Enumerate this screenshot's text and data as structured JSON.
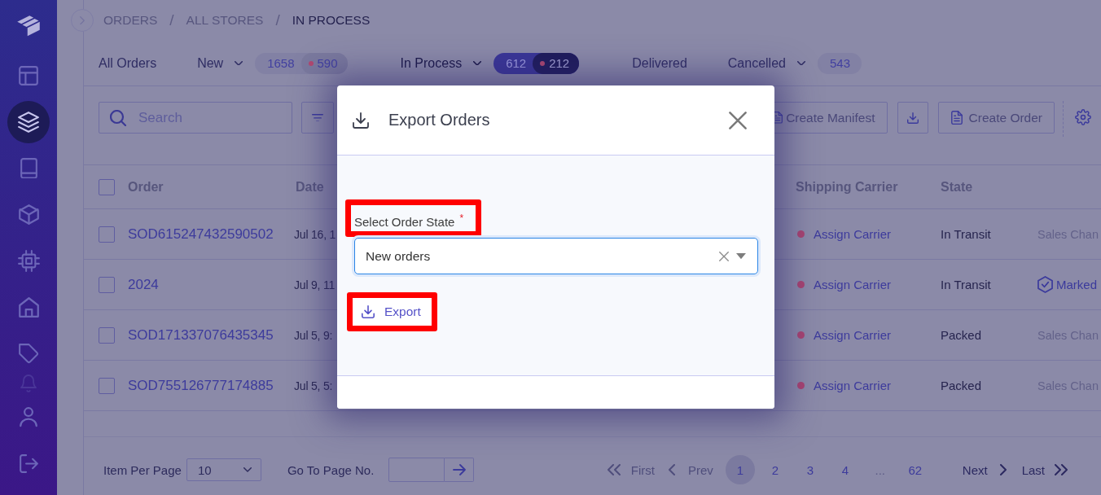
{
  "sidebar": {
    "items": [
      {
        "selected": false,
        "faded": false
      },
      {
        "selected": true,
        "faded": false
      },
      {
        "selected": false,
        "faded": false
      },
      {
        "selected": false,
        "faded": false
      },
      {
        "selected": false,
        "faded": false
      },
      {
        "selected": false,
        "faded": false
      },
      {
        "selected": false,
        "faded": false
      },
      {
        "selected": false,
        "faded": true
      },
      {
        "selected": false,
        "faded": false
      },
      {
        "selected": false,
        "faded": false
      }
    ]
  },
  "breadcrumb": {
    "items": [
      {
        "label": "ORDERS",
        "separator": "/",
        "current": false
      },
      {
        "label": "ALL STORES",
        "separator": "/",
        "current": false
      },
      {
        "label": "IN PROCESS",
        "current": true
      }
    ]
  },
  "tabs": [
    {
      "label": "All Orders",
      "selected": false,
      "dropdown": false
    },
    {
      "label": "New",
      "selected": false,
      "dropdown": true,
      "count": "1658",
      "alert_count": "590"
    },
    {
      "label": "In Process",
      "selected": true,
      "dropdown": true,
      "count": "612",
      "alert_count": "212"
    },
    {
      "label": "Delivered",
      "selected": false,
      "dropdown": false
    },
    {
      "label": "Cancelled",
      "selected": false,
      "dropdown": true,
      "count": "543"
    }
  ],
  "toolbar": {
    "search": {
      "placeholder": "Search"
    },
    "buttons": [
      {
        "kind": "filter"
      },
      {
        "kind": "manifest",
        "label": "Create Manifest"
      },
      {
        "kind": "download"
      },
      {
        "kind": "create",
        "label": "Create Order"
      },
      {
        "kind": "settings"
      }
    ]
  },
  "table": {
    "all_checked": false,
    "columns": [
      "Order",
      "Date",
      "Shipping Carrier",
      "State"
    ],
    "rows": [
      {
        "checked": false,
        "order": "SOD615247432590502",
        "date": "Jul 16, 1",
        "carrier": "Assign Carrier",
        "state": "In Transit",
        "column_5": {
          "kind": "text",
          "text": "Sales Chan"
        }
      },
      {
        "checked": false,
        "order": "2024",
        "date": "Jul 9, 11",
        "carrier": "Assign Carrier",
        "state": "In Transit",
        "column_5": {
          "kind": "verified",
          "text": "Marked"
        }
      },
      {
        "checked": false,
        "order": "SOD171337076435345",
        "date": "Jul 5, 9:",
        "carrier": "Assign Carrier",
        "state": "Packed",
        "column_5": {
          "kind": "text",
          "text": "Sales Chan"
        }
      },
      {
        "checked": false,
        "order": "SOD755126777174885",
        "date": "Jul 5, 5:",
        "carrier": "Assign Carrier",
        "state": "Packed",
        "column_5": {
          "kind": "text",
          "text": "Sales Chan"
        }
      }
    ]
  },
  "pagination": {
    "per_page_label": "Item Per Page",
    "per_page": "10",
    "goto_label": "Go To Page No.",
    "first": {
      "label": "First",
      "disabled": true
    },
    "prev": {
      "label": "Prev",
      "disabled": true
    },
    "pages": [
      {
        "label": "1",
        "kind": "page",
        "selected": true
      },
      {
        "label": "2",
        "kind": "page",
        "selected": false
      },
      {
        "label": "3",
        "kind": "page",
        "selected": false
      },
      {
        "label": "4",
        "kind": "page",
        "selected": false
      },
      {
        "label": "...",
        "kind": "ellipsis",
        "selected": false
      },
      {
        "label": "62",
        "kind": "page",
        "selected": false
      }
    ],
    "next": {
      "label": "Next",
      "disabled": false
    },
    "last": {
      "label": "Last",
      "disabled": false
    }
  },
  "modal": {
    "title": "Export Orders",
    "field": {
      "label": "Select Order State",
      "required_mark": "*",
      "highlighted": true,
      "value": "New orders",
      "focused": true
    },
    "export_button": {
      "label": "Export",
      "highlighted": true
    }
  }
}
